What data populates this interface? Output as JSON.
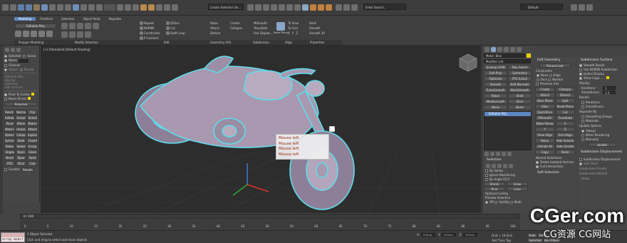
{
  "colors": {
    "accent": "#5d86c0",
    "viewport_bg": "#2b2b2b",
    "bike": "#a898b0",
    "outline": "#5fdcea",
    "tooltip_text": "#9c2a16",
    "grid": "#3a3a3a"
  },
  "title": {
    "workspace": "Default",
    "search_hint": "Enter Search..",
    "left_field": "Create Selection Se..."
  },
  "ribbon": {
    "tabs": [
      "Modeling",
      "Freeform",
      "Selection",
      "Object Paint",
      "Populate"
    ],
    "group_labels": [
      "Polygon Modeling",
      "Modify Selection",
      "Edit",
      "Geometry (All)",
      "Subdivision",
      "Align",
      "Properties"
    ],
    "left_labels": [
      "Editable Poly"
    ],
    "edit_items": [
      "Repeat",
      "QSlice",
      "Swift Loop",
      "NURMS",
      "Cut",
      "P Connect",
      "Constraints"
    ],
    "geometry_items": [
      "Relax",
      "Create",
      "Attach",
      "Collapse",
      "Detach"
    ],
    "subdiv_items": [
      "MSmooth",
      "Tessellate",
      "Use Displac..."
    ],
    "align_items": [
      "To View",
      "To Grid",
      "X",
      "Y",
      "Z"
    ],
    "props_items": [
      "Hard",
      "Smooth",
      "Smooth 30"
    ],
    "make_planar": "Make Planar"
  },
  "left_panel": {
    "items": [
      "Selected",
      "Scene",
      "Name",
      "Channel",
      "Object",
      "Reveal"
    ],
    "sections": [
      "Editable Poly",
      "Display",
      "Selection",
      "Edit Vertices"
    ],
    "checkboxes": [
      "Pivot To Center",
      "Reset XForm"
    ],
    "preserve": "Preserve",
    "grid_buttons": [
      "Reset XForm",
      "Normal",
      "Flip",
      "Editable Poly",
      "Smooth",
      "TurboSmooth",
      "Pivot",
      "Xform",
      "Materials",
      "Mesh Edit",
      "Unwrap",
      "Attach",
      "Detach",
      "Collapse",
      "Explode",
      "Symmetry",
      "Shell",
      "Chamfer",
      "Relax",
      "Select",
      "Group",
      "Ungroup",
      "Open",
      "Close",
      "Bend",
      "Taper",
      "Twist",
      "FFD",
      "Slice",
      "Cap"
    ],
    "counter_label": "Counter",
    "rename": "Rename"
  },
  "viewport": {
    "label": "[+] [Standard] [Default Shading]",
    "tooltip_lines": [
      "Mouse left",
      "Mouse left",
      "Mouse left",
      "Mouse left"
    ]
  },
  "modifier_panel": {
    "object_name": "Motor_Bike",
    "modifier_list": "Modifier List",
    "buttons": [
      "Unwrap UVW",
      "Poly Select",
      "Edit Poly",
      "Symmetry",
      "Optimize",
      "FFD 2x2x2",
      "Smooth",
      "Edit Normals",
      "TurboSmooth",
      "MeshSmooth",
      "Relax",
      "Shell",
      "Meshsmooth",
      "Slice",
      "Noise",
      "Bend"
    ],
    "stack_item": "Editable Poly",
    "rollouts": [
      "Selection",
      "Soft Selection"
    ],
    "selection_opts": [
      "By Vertex",
      "Ignore Backfacing",
      "By Angle",
      "45.0",
      "Shrink",
      "Grow",
      "Ring",
      "Loop"
    ],
    "optional_culling": "Optional Culling",
    "preview_selection": "Preview Selection",
    "preview_opts": [
      "Off",
      "SubObj",
      "Multi"
    ]
  },
  "edit_geometry": {
    "title": "Edit Geometry",
    "repeat_last": "Repeat Last",
    "constraints": "Constraints",
    "opts": [
      "None",
      "Edge",
      "Face",
      "Normal"
    ],
    "preserve_uvs": "Preserve UVs",
    "buttons": [
      "Create",
      "Collapse",
      "Attach",
      "Detach",
      "Slice Plane",
      "Split",
      "Slice",
      "Reset Plane",
      "QuickSlice",
      "Cut",
      "MSmooth",
      "Tessellate",
      "Make Planar",
      "X",
      "Y",
      "Z",
      "View Align",
      "Grid Align",
      "Relax",
      "Hide Selected",
      "Unhide All",
      "Hide Unselected",
      "Copy",
      "Paste"
    ],
    "named_selections": "Named Selections:",
    "delete_isolated": "Delete Isolated Vertices",
    "full_interactivity": "Full Interactivity",
    "soft_selection": "Soft Selection"
  },
  "subdiv": {
    "title": "Subdivision Surface",
    "opts": [
      "Smooth Result",
      "Use NURMS Subdivision",
      "Isoline Display",
      "Show Cage......"
    ],
    "display": "Display",
    "iterations_label": "Iterations:",
    "iterations": "1",
    "smoothness_label": "Smoothness:",
    "smoothness": "1.0",
    "render": "Render",
    "separate_by": "Separate By",
    "sep_opts": [
      "Smoothing Groups",
      "Materials"
    ],
    "update": "Update Options",
    "update_opts": [
      "Always",
      "When Rendering",
      "Manually"
    ],
    "update_btn": "Update",
    "disp_title": "Subdivision Displacement",
    "disp_opts": [
      "Subdivision Displacement",
      "Split Mesh"
    ],
    "presets": "Subdivision Presets",
    "method": "Subdivision Method",
    "steps": "Steps"
  },
  "timeline": {
    "frame": "0 / 100",
    "ticks": [
      "0",
      "5",
      "10",
      "15",
      "20",
      "25",
      "30",
      "35",
      "40",
      "45",
      "50",
      "55",
      "60",
      "65",
      "70",
      "75",
      "80",
      "85",
      "90",
      "95",
      "100"
    ]
  },
  "status": {
    "selected": "1 Object Selected",
    "prompt": "Click and drag to select and move objects",
    "script": "array modif",
    "x": "0.0cm",
    "y": "0.0cm",
    "z": "0.0cm",
    "grid": "Grid = 10.0cm",
    "add_tag": "Add Time Tag",
    "auto": "Auto",
    "set_key": "Set K.",
    "selected_btn": "Selected",
    "key_filters": "Key Filters..."
  },
  "watermark": {
    "main": "CGer.com",
    "sub": "CG资源 CG网站"
  }
}
